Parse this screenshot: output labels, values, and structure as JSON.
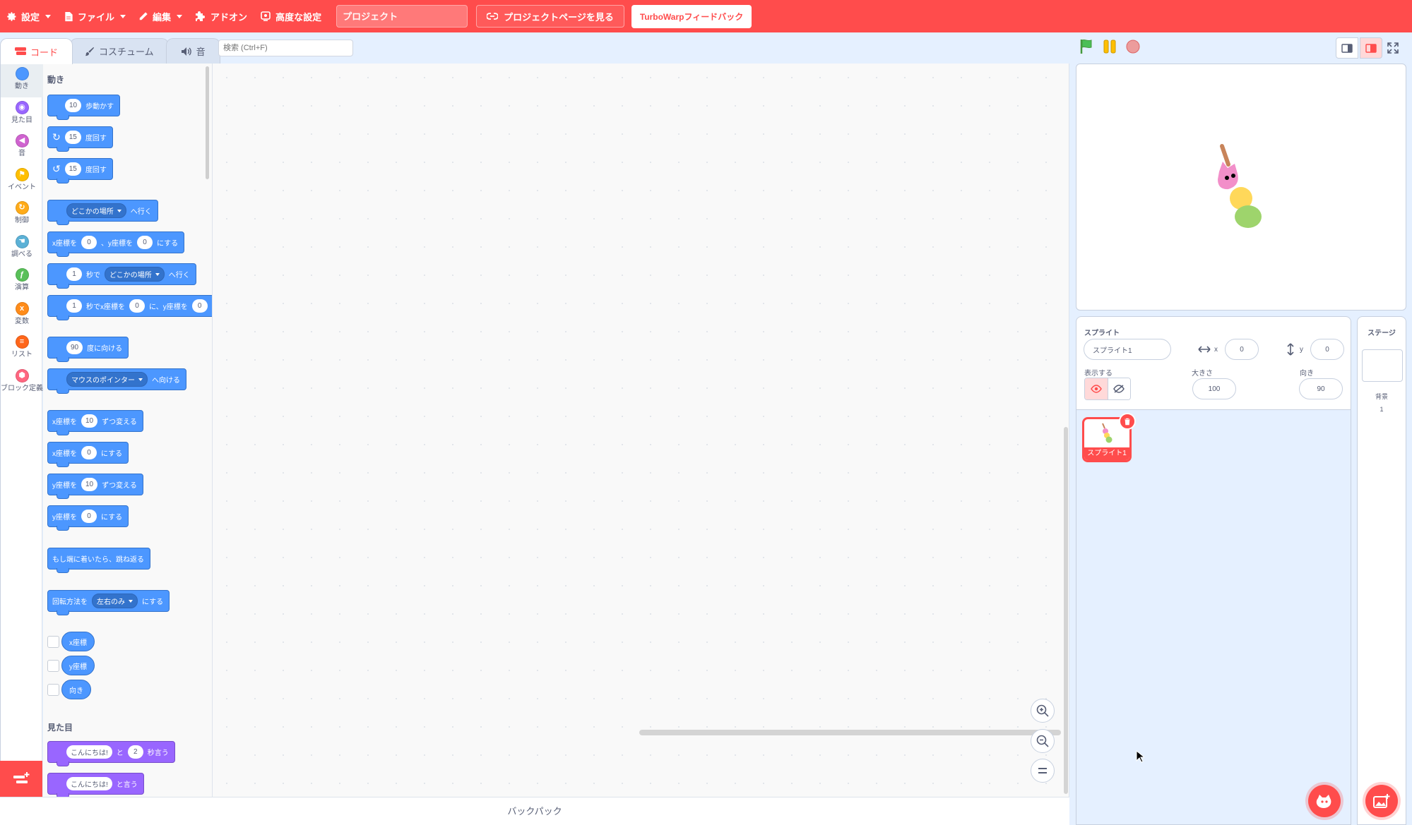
{
  "menu": {
    "settings": "設定",
    "file": "ファイル",
    "edit": "編集",
    "addons": "アドオン",
    "advanced": "高度な設定",
    "project_title_placeholder": "プロジェクト",
    "project_page": "プロジェクトページを見る",
    "feedback": "TurboWarpフィードバック"
  },
  "tabs": {
    "code": "コード",
    "costumes": "コスチューム",
    "sounds": "音"
  },
  "search_placeholder": "検索 (Ctrl+F)",
  "categories": [
    {
      "label": "動き",
      "color": "#4c97ff"
    },
    {
      "label": "見た目",
      "color": "#9966ff"
    },
    {
      "label": "音",
      "color": "#cf63cf"
    },
    {
      "label": "イベント",
      "color": "#ffbf00"
    },
    {
      "label": "制御",
      "color": "#ffab19"
    },
    {
      "label": "調べる",
      "color": "#5cb1d6"
    },
    {
      "label": "演算",
      "color": "#59c059"
    },
    {
      "label": "変数",
      "color": "#ff8c1a"
    },
    {
      "label": "リスト",
      "color": "#ff661a"
    },
    {
      "label": "ブロック定義",
      "color": "#ff6680"
    }
  ],
  "palette": {
    "motion_title": "動き",
    "looks_title": "見た目",
    "move": {
      "value": "10",
      "text": "歩動かす"
    },
    "turn_right": {
      "value": "15",
      "text": "度回す"
    },
    "turn_left": {
      "value": "15",
      "text": "度回す"
    },
    "goto": {
      "menu": "どこかの場所",
      "text": "へ行く"
    },
    "goto_xy": {
      "a": "x座標を",
      "x": "0",
      "b": "、y座標を",
      "y": "0",
      "c": "にする"
    },
    "glide_to": {
      "secs": "1",
      "a": "秒で",
      "menu": "どこかの場所",
      "b": "へ行く"
    },
    "glide_xy": {
      "secs": "1",
      "a": "秒でx座標を",
      "x": "0",
      "b": "に、y座標を",
      "y": "0"
    },
    "point_dir": {
      "value": "90",
      "text": "度に向ける"
    },
    "point_towards": {
      "menu": "マウスのポインター",
      "text": "へ向ける"
    },
    "change_x": {
      "a": "x座標を",
      "value": "10",
      "b": "ずつ変える"
    },
    "set_x": {
      "a": "x座標を",
      "value": "0",
      "b": "にする"
    },
    "change_y": {
      "a": "y座標を",
      "value": "10",
      "b": "ずつ変える"
    },
    "set_y": {
      "a": "y座標を",
      "value": "0",
      "b": "にする"
    },
    "bounce": "もし端に着いたら、跳ね返る",
    "rotation": {
      "a": "回転方法を",
      "menu": "左右のみ",
      "b": "にする"
    },
    "rep_x": "x座標",
    "rep_y": "y座標",
    "rep_dir": "向き",
    "say_for": {
      "msg": "こんにちは!",
      "a": "と",
      "secs": "2",
      "b": "秒言う"
    },
    "say": {
      "msg": "こんにちは!",
      "a": "と言う"
    }
  },
  "backpack": "バックパック",
  "sprite_info": {
    "sprite_label": "スプライト",
    "sprite_name": "スプライト1",
    "x_label": "x",
    "x_value": "0",
    "y_label": "y",
    "y_value": "0",
    "show_label": "表示する",
    "size_label": "大きさ",
    "size_value": "100",
    "direction_label": "向き",
    "direction_value": "90"
  },
  "sprite_list": [
    {
      "name": "スプライト1",
      "selected": true
    }
  ],
  "stage_panel": {
    "title": "ステージ",
    "backdrops_label": "背景",
    "backdrops_count": "1"
  },
  "colors": {
    "accent": "#ff4c4c",
    "motion": "#4c97ff",
    "looks": "#9966ff",
    "workspace_bg": "#f9f9f9",
    "page_bg": "#e5f0ff"
  }
}
